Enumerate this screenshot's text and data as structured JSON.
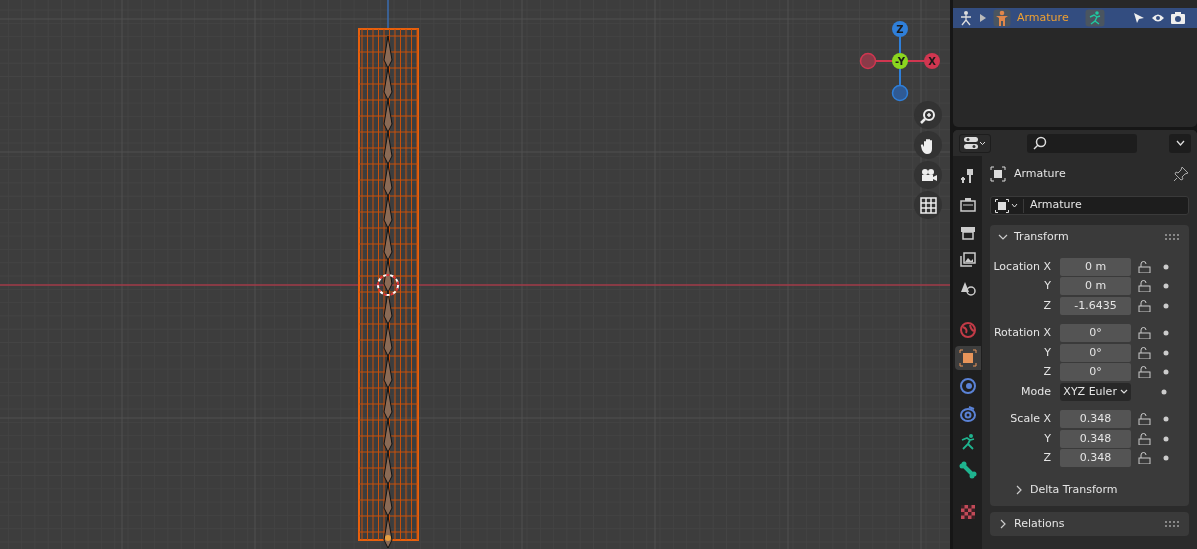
{
  "viewport": {
    "gizmo": [
      {
        "label": "Z",
        "kind": "z"
      },
      {
        "label": "-Y",
        "kind": "y"
      },
      {
        "label": "X",
        "kind": "x"
      },
      {
        "kind": "neg_x"
      },
      {
        "kind": "neg_z"
      }
    ]
  },
  "outliner": {
    "rows": [
      {
        "name": "Armature",
        "selected": true,
        "expanded": false
      }
    ]
  },
  "properties": {
    "tabs": [
      {
        "kind": "tool",
        "selected": false
      },
      {
        "kind": "render",
        "selected": false
      },
      {
        "kind": "output",
        "selected": false
      },
      {
        "kind": "view_layer",
        "selected": false
      },
      {
        "kind": "scene",
        "selected": false
      },
      {
        "kind": "world",
        "selected": false
      },
      {
        "kind": "object",
        "selected": true
      },
      {
        "kind": "modifier",
        "selected": false
      },
      {
        "kind": "constraint",
        "selected": false
      },
      {
        "kind": "data",
        "selected": false
      },
      {
        "kind": "bone",
        "selected": false
      },
      {
        "kind": "texture",
        "selected": false
      }
    ],
    "title": "Armature",
    "name_field": "Armature",
    "panels": [
      {
        "title": "Transform",
        "expanded": true,
        "groups": [
          [
            {
              "label": "Location X",
              "value": "0 m",
              "kind": "number"
            },
            {
              "label": "Y",
              "value": "0 m",
              "kind": "number"
            },
            {
              "label": "Z",
              "value": "-1.6435",
              "kind": "number"
            }
          ],
          [
            {
              "label": "Rotation X",
              "value": "0°",
              "kind": "number"
            },
            {
              "label": "Y",
              "value": "0°",
              "kind": "number"
            },
            {
              "label": "Z",
              "value": "0°",
              "kind": "number"
            },
            {
              "label": "Mode",
              "value": "XYZ Euler",
              "kind": "dropdown"
            }
          ],
          [
            {
              "label": "Scale X",
              "value": "0.348",
              "kind": "number"
            },
            {
              "label": "Y",
              "value": "0.348",
              "kind": "number"
            },
            {
              "label": "Z",
              "value": "0.348",
              "kind": "number"
            }
          ]
        ],
        "subpanels": [
          {
            "title": "Delta Transform",
            "expanded": false
          }
        ]
      },
      {
        "title": "Relations",
        "expanded": false
      }
    ]
  }
}
